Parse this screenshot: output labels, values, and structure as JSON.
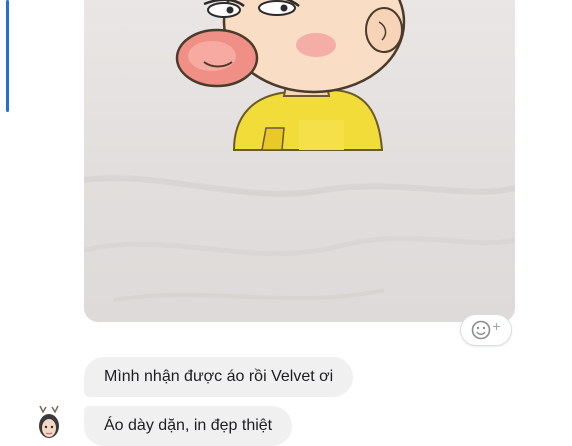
{
  "conversation": {
    "messages": [
      {
        "sender": "customer",
        "type": "photo",
        "description_icon": "image"
      },
      {
        "sender": "customer",
        "type": "text",
        "text": "Mình nhận được áo rồi Velvet ơi"
      },
      {
        "sender": "customer",
        "type": "text",
        "text": "Áo dày dặn, in đẹp thiệt"
      }
    ]
  },
  "reaction": {
    "icon": "smiley-plus-icon",
    "plus": "+"
  },
  "colors": {
    "bubble": "#f1f0f0",
    "accent": "#1e6fd6",
    "text": "#1c1e21"
  }
}
